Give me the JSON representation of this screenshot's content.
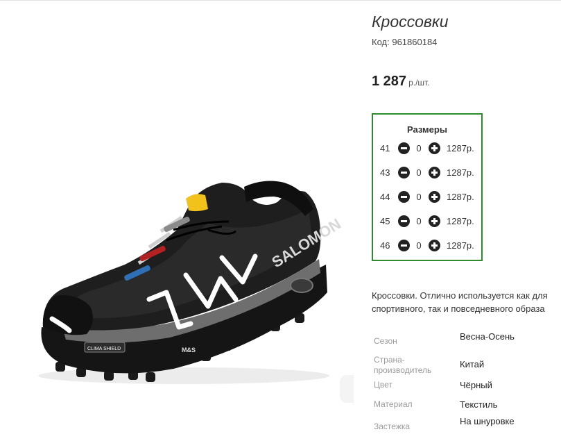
{
  "product": {
    "title": "Кроссовки",
    "code_label": "Код:",
    "code_value": "961860184",
    "price": "1 287",
    "price_unit": "р./шт.",
    "image_brand": "SALOMON",
    "image_badge_1": "CLIMA SHIELD",
    "image_badge_2": "M&S"
  },
  "sizes": {
    "heading": "Размеры",
    "rows": [
      {
        "size": "41",
        "qty": "0",
        "price": "1287р."
      },
      {
        "size": "43",
        "qty": "0",
        "price": "1287р."
      },
      {
        "size": "44",
        "qty": "0",
        "price": "1287р."
      },
      {
        "size": "45",
        "qty": "0",
        "price": "1287р."
      },
      {
        "size": "46",
        "qty": "0",
        "price": "1287р."
      }
    ]
  },
  "description": {
    "line1": "Кроссовки. Отлично используется как для",
    "line2": "спортивного, так и повседневного образа"
  },
  "attributes": [
    {
      "key": "Сезон",
      "value": "Весна-Осень"
    },
    {
      "key": "Страна-производитель",
      "value": "Китай"
    },
    {
      "key": "Цвет",
      "value": "Чёрный"
    },
    {
      "key": "Материал",
      "value": "Текстиль"
    },
    {
      "key": "Застежка",
      "value": "На шнуровке"
    }
  ],
  "colors": {
    "sizes_border": "#2e8b2e",
    "control": "#222222"
  },
  "icons": {
    "minus": "minus-circle-icon",
    "plus": "plus-circle-icon"
  }
}
